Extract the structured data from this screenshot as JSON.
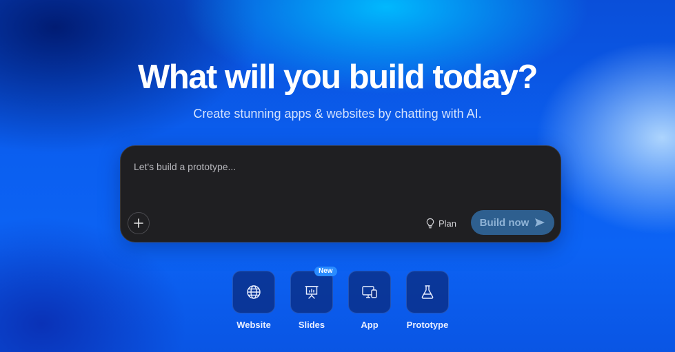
{
  "hero": {
    "title": "What will you build today?",
    "subtitle": "Create stunning apps & websites by chatting with AI."
  },
  "prompt": {
    "placeholder": "Let's build a prototype...",
    "value": "",
    "attach_icon": "plus-icon",
    "plan_label": "Plan",
    "plan_icon": "lightbulb-icon",
    "build_label": "Build now",
    "build_icon": "send-arrow-icon",
    "build_button_color": "#2e5f8f"
  },
  "project_types": [
    {
      "label": "Website",
      "icon": "globe-icon",
      "badge": ""
    },
    {
      "label": "Slides",
      "icon": "presentation-chart-icon",
      "badge": "New"
    },
    {
      "label": "App",
      "icon": "devices-icon",
      "badge": ""
    },
    {
      "label": "Prototype",
      "icon": "flask-icon",
      "badge": ""
    }
  ],
  "colors": {
    "accent": "#0b5ff0",
    "badge": "#2a8cff",
    "panel": "#1f1f22"
  }
}
